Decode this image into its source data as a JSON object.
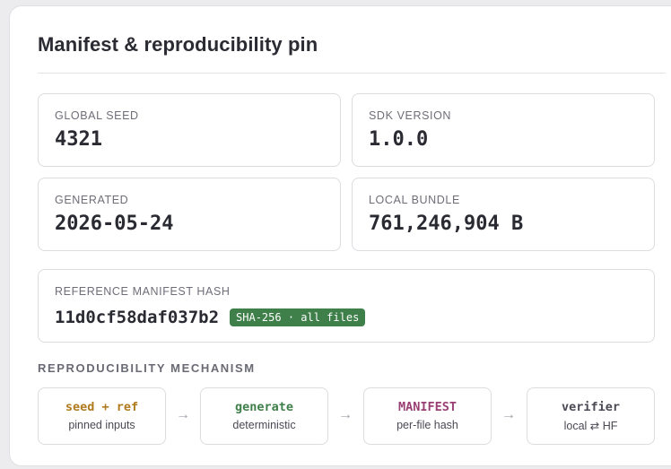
{
  "panel": {
    "title": "Manifest & reproducibility pin"
  },
  "stats": {
    "global_seed": {
      "label": "GLOBAL SEED",
      "value": "4321"
    },
    "sdk_version": {
      "label": "SDK VERSION",
      "value": "1.0.0"
    },
    "generated": {
      "label": "GENERATED",
      "value": "2026-05-24"
    },
    "local_bundle": {
      "label": "LOCAL BUNDLE",
      "value": "761,246,904 B"
    }
  },
  "manifest_hash": {
    "label": "REFERENCE MANIFEST HASH",
    "value": "11d0cf58daf037b2",
    "badge": "SHA-256 · all files",
    "badge_color": "#3e7f4a"
  },
  "mechanism": {
    "title": "REPRODUCIBILITY MECHANISM",
    "arrow": "→",
    "steps": [
      {
        "code": "seed + ref",
        "sub": "pinned inputs",
        "color": "#b07a1e"
      },
      {
        "code": "generate",
        "sub": "deterministic",
        "color": "#3e7f4a"
      },
      {
        "code": "MANIFEST",
        "sub": "per-file hash",
        "color": "#9a3f74"
      },
      {
        "code": "verifier",
        "sub": "local ⇄ HF",
        "color": "#4a4a55"
      }
    ]
  }
}
